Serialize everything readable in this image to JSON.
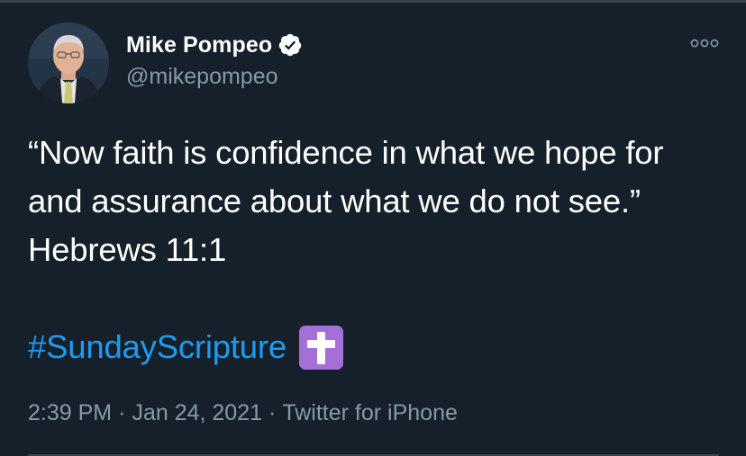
{
  "user": {
    "display_name": "Mike Pompeo",
    "handle": "@mikepompeo",
    "verified": true
  },
  "tweet": {
    "text": "“Now faith is confidence in what we hope for and assurance about what we do not see.” Hebrews 11:1",
    "hashtag": "#SundayScripture",
    "emoji": "latin-cross-emoji",
    "time": "2:39 PM",
    "date": "Jan 24, 2021",
    "source": "Twitter for iPhone",
    "separator": "·"
  },
  "icons": {
    "verified": "verified-badge-icon",
    "more": "more-options-icon"
  },
  "colors": {
    "background": "#15202b",
    "text": "#ffffff",
    "secondary_text": "#8899a6",
    "link": "#1d9bf0",
    "emoji_bg": "#a46fd7",
    "divider": "#38444d"
  }
}
